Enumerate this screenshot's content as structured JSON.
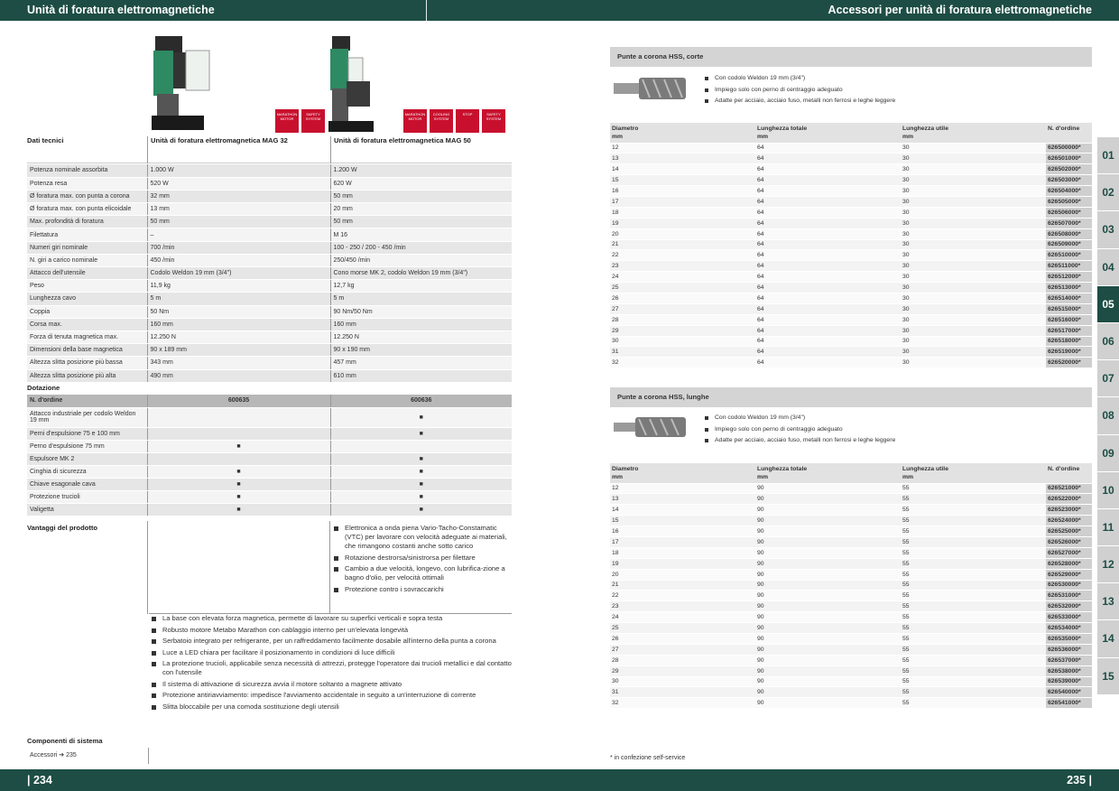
{
  "header": {
    "left_title": "Unità di foratura elettromagnetiche",
    "right_title": "Accessori per unità di foratura elettromagnetiche"
  },
  "footer": {
    "left_page": "| 234",
    "right_page": "235 |"
  },
  "badges": {
    "marathon": "MARATHON MOTOR",
    "safety": "SAFETY SYSTEM",
    "cooling": "COOLING SYSTEM",
    "stop": "STOP"
  },
  "tech": {
    "section_label": "Dati tecnici",
    "col1": "Unità di foratura elettromagnetica MAG 32",
    "col2": "Unità di foratura elettromagnetica MAG 50",
    "rows": [
      [
        "Potenza nominale assorbita",
        "1.000 W",
        "1.200 W"
      ],
      [
        "Potenza resa",
        "520 W",
        "620 W"
      ],
      [
        "Ø foratura max. con punta a corona",
        "32 mm",
        "50 mm"
      ],
      [
        "Ø foratura max. con punta elicoidale",
        "13 mm",
        "20 mm"
      ],
      [
        "Max. profondità di foratura",
        "50 mm",
        "50 mm"
      ],
      [
        "Filettatura",
        "–",
        "M 16"
      ],
      [
        "Numeri giri nominale",
        "700 /min",
        "100 - 250 / 200 - 450 /min"
      ],
      [
        "N. giri a carico nominale",
        "450 /min",
        "250/450 /min"
      ],
      [
        "Attacco dell'utensile",
        "Codolo Weldon 19 mm (3/4\")",
        "Cono morse MK 2, codolo Weldon 19 mm (3/4\")"
      ],
      [
        "Peso",
        "11,9 kg",
        "12,7 kg"
      ],
      [
        "Lunghezza cavo",
        "5 m",
        "5 m"
      ],
      [
        "Coppia",
        "50 Nm",
        "90 Nm/50 Nm"
      ],
      [
        "Corsa max.",
        "160 mm",
        "160 mm"
      ],
      [
        "Forza di tenuta magnetica max.",
        "12.250 N",
        "12.250 N"
      ],
      [
        "Dimensioni della base magnetica",
        "90 x 189 mm",
        "90 x 190 mm"
      ],
      [
        "Altezza slitta posizione più bassa",
        "343 mm",
        "457 mm"
      ],
      [
        "Altezza slitta posizione più alta",
        "490 mm",
        "610 mm"
      ]
    ]
  },
  "supply": {
    "section_label": "Dotazione",
    "head": [
      "N. d'ordine",
      "600635",
      "600636"
    ],
    "rows": [
      [
        "Attacco industriale per codolo Weldon 19 mm",
        "",
        "■"
      ],
      [
        "Perni d'espulsione 75 e 100 mm",
        "",
        "■"
      ],
      [
        "Perno d'espulsione 75 mm",
        "■",
        ""
      ],
      [
        "Espulsore MK 2",
        "",
        "■"
      ],
      [
        "Cinghia di sicurezza",
        "■",
        "■"
      ],
      [
        "Chiave esagonale cava",
        "■",
        "■"
      ],
      [
        "Protezione trucioli",
        "■",
        "■"
      ],
      [
        "Valigetta",
        "■",
        "■"
      ]
    ]
  },
  "advantages": {
    "section_label": "Vantaggi del prodotto",
    "mag50_only": [
      "Elettronica a onda piena Vario-Tacho-Constamatic (VTC) per lavorare con velocità adeguate ai materiali, che rimangono costanti anche sotto carico",
      "Rotazione destrorsa/sinistrorsa per filettare",
      "Cambio a due velocità, longevo, con lubrifica-zione a bagno d'olio, per velocità ottimali",
      "Protezione contro i sovraccarichi"
    ],
    "both": [
      "La base con elevata forza magnetica, permette di lavorare su superfici verticali e sopra testa",
      "Robusto motore Metabo Marathon con cablaggio interno per un'elevata longevità",
      "Serbatoio integrato per refrigerante, per un raffreddamento facilmente dosabile all'interno della punta a corona",
      "Luce a LED chiara per facilitare il posizionamento in condizioni di luce difficili",
      "La protezione trucioli, applicabile senza necessità di attrezzi, protegge l'operatore dai trucioli metallici e dal contatto con l'utensile",
      "Il sistema di attivazione di sicurezza avvia il motore soltanto a magnete attivato",
      "Protezione antiriavviamento: impedisce l'avviamento accidentale in seguito a un'interruzione di corrente",
      "Slitta bloccabile per una comoda sostituzione degli utensili"
    ]
  },
  "system": {
    "section_label": "Componenti di sistema",
    "accessory": "Accessori ➔ 235"
  },
  "short": {
    "title": "Punte a corona HSS, corte",
    "bullets": [
      "Con codolo Weldon 19 mm (3/4\")",
      "Impiego solo con perno di centraggio adeguato",
      "Adatte per acciaio, acciaio fuso, metalli non ferrosi e leghe leggere"
    ],
    "headers": [
      [
        "Diametro",
        "mm"
      ],
      [
        "Lunghezza totale",
        "mm"
      ],
      [
        "Lunghezza utile",
        "mm"
      ],
      [
        "N. d'ordine",
        ""
      ]
    ],
    "rows": [
      [
        "12",
        "64",
        "30",
        "626500000*"
      ],
      [
        "13",
        "64",
        "30",
        "626501000*"
      ],
      [
        "14",
        "64",
        "30",
        "626502000*"
      ],
      [
        "15",
        "64",
        "30",
        "626503000*"
      ],
      [
        "16",
        "64",
        "30",
        "626504000*"
      ],
      [
        "17",
        "64",
        "30",
        "626505000*"
      ],
      [
        "18",
        "64",
        "30",
        "626506000*"
      ],
      [
        "19",
        "64",
        "30",
        "626507000*"
      ],
      [
        "20",
        "64",
        "30",
        "626508000*"
      ],
      [
        "21",
        "64",
        "30",
        "626509000*"
      ],
      [
        "22",
        "64",
        "30",
        "626510000*"
      ],
      [
        "23",
        "64",
        "30",
        "626511000*"
      ],
      [
        "24",
        "64",
        "30",
        "626512000*"
      ],
      [
        "25",
        "64",
        "30",
        "626513000*"
      ],
      [
        "26",
        "64",
        "30",
        "626514000*"
      ],
      [
        "27",
        "64",
        "30",
        "626515000*"
      ],
      [
        "28",
        "64",
        "30",
        "626516000*"
      ],
      [
        "29",
        "64",
        "30",
        "626517000*"
      ],
      [
        "30",
        "64",
        "30",
        "626518000*"
      ],
      [
        "31",
        "64",
        "30",
        "626519000*"
      ],
      [
        "32",
        "64",
        "30",
        "626520000*"
      ]
    ]
  },
  "long": {
    "title": "Punte a corona HSS, lunghe",
    "bullets": [
      "Con codolo Weldon 19 mm (3/4\")",
      "Impiego solo con perno di centraggio adeguato",
      "Adatte per acciaio, acciaio fuso, metalli non ferrosi e leghe leggere"
    ],
    "headers": [
      [
        "Diametro",
        "mm"
      ],
      [
        "Lunghezza totale",
        "mm"
      ],
      [
        "Lunghezza utile",
        "mm"
      ],
      [
        "N. d'ordine",
        ""
      ]
    ],
    "rows": [
      [
        "12",
        "90",
        "55",
        "626521000*"
      ],
      [
        "13",
        "90",
        "55",
        "626522000*"
      ],
      [
        "14",
        "90",
        "55",
        "626523000*"
      ],
      [
        "15",
        "90",
        "55",
        "626524000*"
      ],
      [
        "16",
        "90",
        "55",
        "626525000*"
      ],
      [
        "17",
        "90",
        "55",
        "626526000*"
      ],
      [
        "18",
        "90",
        "55",
        "626527000*"
      ],
      [
        "19",
        "90",
        "55",
        "626528000*"
      ],
      [
        "20",
        "90",
        "55",
        "626529000*"
      ],
      [
        "21",
        "90",
        "55",
        "626530000*"
      ],
      [
        "22",
        "90",
        "55",
        "626531000*"
      ],
      [
        "23",
        "90",
        "55",
        "626532000*"
      ],
      [
        "24",
        "90",
        "55",
        "626533000*"
      ],
      [
        "25",
        "90",
        "55",
        "626534000*"
      ],
      [
        "26",
        "90",
        "55",
        "626535000*"
      ],
      [
        "27",
        "90",
        "55",
        "626536000*"
      ],
      [
        "28",
        "90",
        "55",
        "626537000*"
      ],
      [
        "29",
        "90",
        "55",
        "626538000*"
      ],
      [
        "30",
        "90",
        "55",
        "626539000*"
      ],
      [
        "31",
        "90",
        "55",
        "626540000*"
      ],
      [
        "32",
        "90",
        "55",
        "626541000*"
      ]
    ]
  },
  "footnote": "* in confezione self-service",
  "chapter_tabs": [
    "01",
    "02",
    "03",
    "04",
    "05",
    "06",
    "07",
    "08",
    "09",
    "10",
    "11",
    "12",
    "13",
    "14",
    "15"
  ],
  "active_tab": "05",
  "colors": {
    "brand": "#1d4d44",
    "badge": "#c8102e"
  }
}
